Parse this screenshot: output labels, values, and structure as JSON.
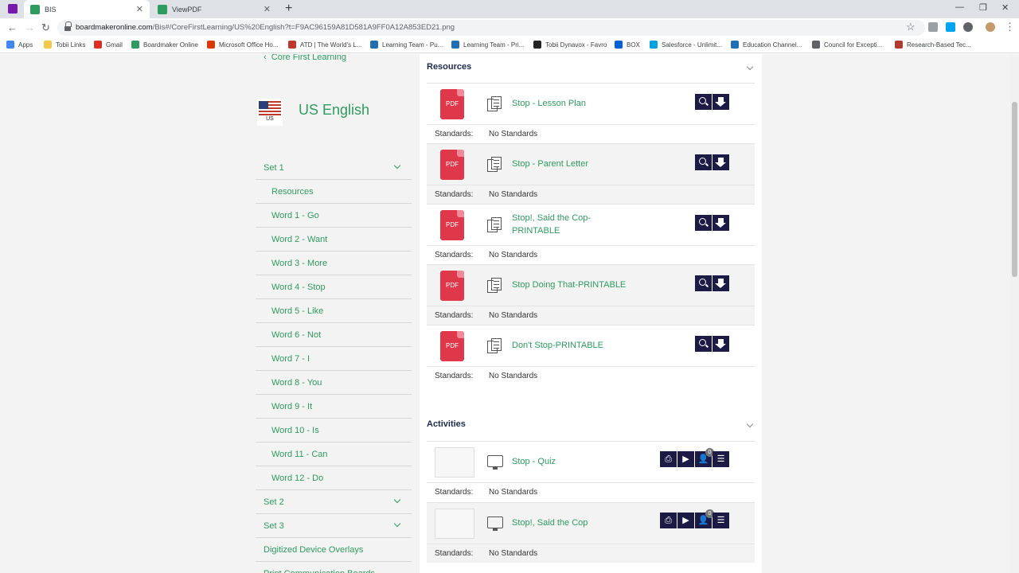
{
  "browser": {
    "tabs": [
      {
        "title": "BIS",
        "active": true,
        "color": "#2e9b5f"
      },
      {
        "title": "ViewPDF",
        "active": false,
        "color": "#2e9b5f"
      }
    ],
    "url_host": "boardmakeronline.com",
    "url_path": "/Bis#/CoreFirstLearning/US%20English?t=F9AC96159A81D581A9FF0A12A853ED21.png",
    "bookmarks": [
      {
        "label": "Apps",
        "icon": "apps-grid-icon",
        "color": "#4285f4"
      },
      {
        "label": "Tobii Links",
        "icon": "folder-icon",
        "color": "#f2c94c"
      },
      {
        "label": "Gmail",
        "icon": "gmail-icon",
        "color": "#d93025"
      },
      {
        "label": "Boardmaker Online",
        "icon": "boardmaker-icon",
        "color": "#2e9b5f"
      },
      {
        "label": "Microsoft Office Ho...",
        "icon": "office-icon",
        "color": "#d83b01"
      },
      {
        "label": "ATD | The World's L...",
        "icon": "atd-icon",
        "color": "#c0392b"
      },
      {
        "label": "Learning Team - Pu...",
        "icon": "learning-icon",
        "color": "#1f6fb2"
      },
      {
        "label": "Learning Team - Pri...",
        "icon": "learning-icon",
        "color": "#1f6fb2"
      },
      {
        "label": "Tobii Dynavox - Favro",
        "icon": "favro-icon",
        "color": "#222222"
      },
      {
        "label": "BOX",
        "icon": "box-icon",
        "color": "#0061d5"
      },
      {
        "label": "Salesforce - Unlimit...",
        "icon": "salesforce-icon",
        "color": "#00a1e0"
      },
      {
        "label": "Education Channel...",
        "icon": "learning-icon",
        "color": "#1f6fb2"
      },
      {
        "label": "Council for Excepti...",
        "icon": "globe-icon",
        "color": "#5f6368"
      },
      {
        "label": "Research-Based Tec...",
        "icon": "research-icon",
        "color": "#b03a2e"
      }
    ]
  },
  "sidebar": {
    "back_label": "Core First Learning",
    "flag_code": "US",
    "language_title": "US English",
    "items": [
      {
        "label": "Set 1",
        "kind": "set",
        "chevron": true
      },
      {
        "label": "Resources",
        "kind": "sub"
      },
      {
        "label": "Word 1 - Go",
        "kind": "sub"
      },
      {
        "label": "Word 2 - Want",
        "kind": "sub"
      },
      {
        "label": "Word 3 - More",
        "kind": "sub"
      },
      {
        "label": "Word 4 - Stop",
        "kind": "sub"
      },
      {
        "label": "Word 5 - Like",
        "kind": "sub"
      },
      {
        "label": "Word 6 - Not",
        "kind": "sub"
      },
      {
        "label": "Word 7 - I",
        "kind": "sub"
      },
      {
        "label": "Word 8 - You",
        "kind": "sub"
      },
      {
        "label": "Word 9 - It",
        "kind": "sub"
      },
      {
        "label": "Word 10 - Is",
        "kind": "sub"
      },
      {
        "label": "Word 11 - Can",
        "kind": "sub"
      },
      {
        "label": "Word 12 - Do",
        "kind": "sub"
      },
      {
        "label": "Set 2",
        "kind": "set",
        "chevron": true
      },
      {
        "label": "Set 3",
        "kind": "set",
        "chevron": true
      },
      {
        "label": "Digitized Device Overlays",
        "kind": "set"
      },
      {
        "label": "Print Communication Boards",
        "kind": "set"
      }
    ]
  },
  "resources": {
    "title": "Resources",
    "standards_label": "Standards:",
    "items": [
      {
        "file_type": "PDF",
        "title": "Stop - Lesson Plan",
        "standards": "No Standards"
      },
      {
        "file_type": "PDF",
        "title": "Stop - Parent Letter",
        "standards": "No Standards"
      },
      {
        "file_type": "PDF",
        "title": "Stop!, Said the Cop-PRINTABLE",
        "standards": "No Standards"
      },
      {
        "file_type": "PDF",
        "title": "Stop Doing That-PRINTABLE",
        "standards": "No Standards"
      },
      {
        "file_type": "PDF",
        "title": "Don't Stop-PRINTABLE",
        "standards": "No Standards"
      }
    ]
  },
  "activities": {
    "title": "Activities",
    "standards_label": "Standards:",
    "items": [
      {
        "title": "Stop - Quiz",
        "standards": "No Standards",
        "badge": "0",
        "icon": "quiz-monitor-icon"
      },
      {
        "title": "Stop!, Said the Cop",
        "standards": "No Standards",
        "badge": "0",
        "icon": "monitor-icon"
      }
    ]
  },
  "colors": {
    "accent_green": "#2e9b5f",
    "button_navy": "#1b1b45",
    "pdf_red": "#e0384b"
  }
}
